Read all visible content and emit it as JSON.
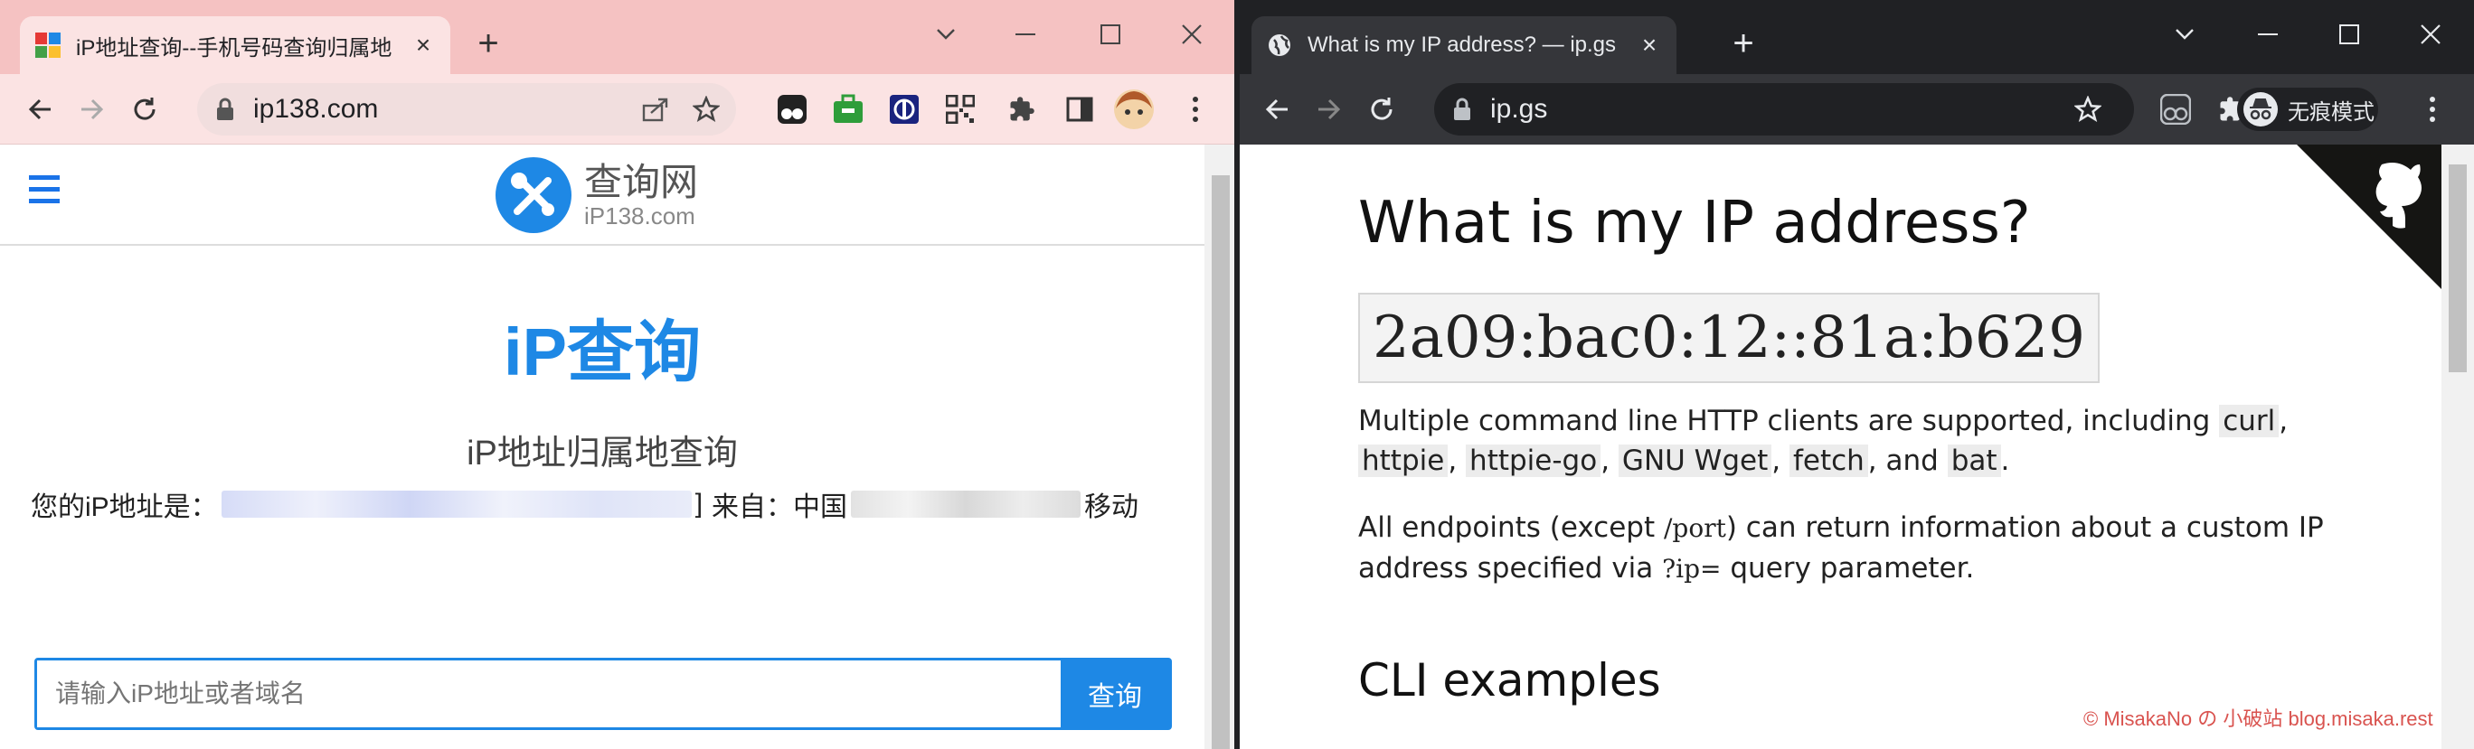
{
  "left": {
    "tab_title": "iP地址查询--手机号码查询归属地",
    "url": "ip138.com",
    "logo_main": "查询网",
    "logo_sub": "iP138.com",
    "page_title": "iP查询",
    "subtitle": "iP地址归属地查询",
    "ip_prefix": "您的iP地址是：",
    "ip_bracket_close": "]",
    "from_label": "来自：中国",
    "carrier": "移动",
    "search_placeholder": "请输入iP地址或者域名",
    "search_button": "查询"
  },
  "right": {
    "tab_title": "What is my IP address? — ip.gs",
    "url": "ip.gs",
    "incognito_label": "无痕模式",
    "heading": "What is my IP address?",
    "ip": "2a09:bac0:12::81a:b629",
    "p1_text1": "Multiple command line HTTP clients are supported, including",
    "p1_curl": "curl",
    "p1_comma1": ",",
    "p1_httpie": "httpie",
    "p1_comma2": ",",
    "p1_httpie_go": "httpie-go",
    "p1_comma3": ",",
    "p1_wget": "GNU Wget",
    "p1_comma4": ",",
    "p1_fetch": "fetch",
    "p1_and": ", and",
    "p1_bat": "bat",
    "p1_end": ".",
    "p2_text1": "All endpoints (except",
    "p2_port": "/port",
    "p2_text2": ") can return information about a custom IP address specified via",
    "p2_ip_param": "?ip=",
    "p2_text3": "query parameter.",
    "cli_heading": "CLI examples",
    "watermark": "© MisakaNo の 小破站 blog.misaka.rest"
  },
  "colors": {
    "left_tabstrip": "#f5c2c2",
    "right_tabstrip": "#202124",
    "accent_blue": "#1e88e5"
  },
  "icons": [
    "ip138-favicon",
    "new-tab-icon",
    "minimize-icon",
    "maximize-icon",
    "close-icon",
    "back-icon",
    "forward-icon",
    "reload-icon",
    "lock-icon",
    "share-icon",
    "star-icon",
    "extension-icon",
    "sidebar-icon",
    "avatar",
    "globe-icon",
    "incognito-icon",
    "menu-icon",
    "github-icon",
    "hamburger-icon"
  ]
}
